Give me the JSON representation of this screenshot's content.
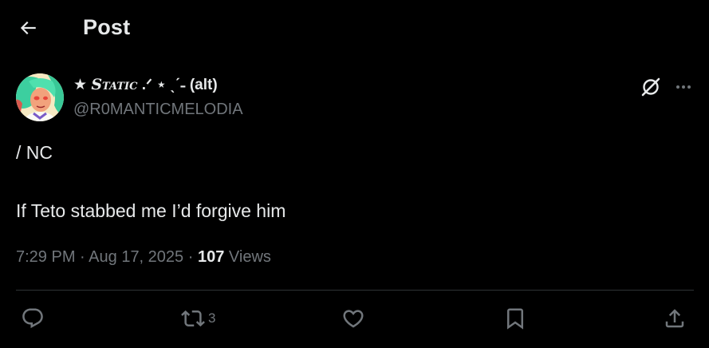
{
  "header": {
    "title": "Post"
  },
  "author": {
    "name_prefix": "★",
    "name_deco": "Static",
    "name_suffix": ".ᐟ ⋆ ˎˊ˗ (alt)",
    "handle": "@R0MANTICMELODIA"
  },
  "tweet": {
    "line1": "/ NC",
    "line2": "If Teto stabbed me I’d forgive him"
  },
  "meta": {
    "time": "7:29 PM",
    "date": "Aug 17, 2025",
    "separator": "·",
    "views_count": "107",
    "views_label": "Views"
  },
  "actions": {
    "repost_count": "3"
  },
  "colors": {
    "background": "#000000",
    "text": "#e7e9ea",
    "muted": "#71767b",
    "divider": "#2f3336"
  },
  "icons": [
    "back-arrow-icon",
    "grok-icon",
    "more-icon",
    "reply-icon",
    "repost-icon",
    "like-icon",
    "bookmark-icon",
    "share-icon"
  ]
}
